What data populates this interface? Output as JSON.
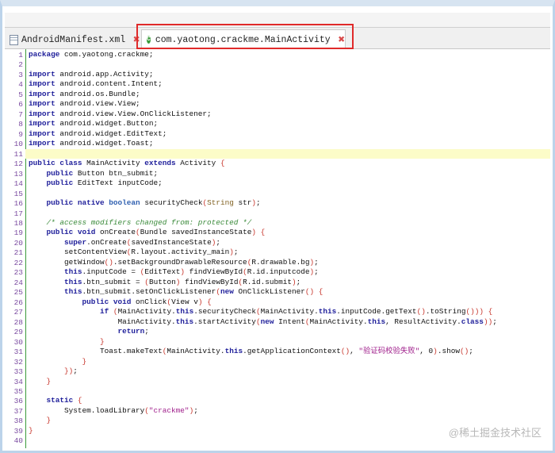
{
  "tabs": [
    {
      "label": "AndroidManifest.xml",
      "icon": "xml-file-icon",
      "active": false
    },
    {
      "label": "com.yaotong.crackme.MainActivity",
      "icon": "class-icon",
      "active": true
    }
  ],
  "current_line": 11,
  "watermark": "@稀土掘金技术社区",
  "code": [
    [
      [
        "k",
        "package"
      ],
      [
        "n",
        " com.yaotong.crackme;"
      ]
    ],
    [],
    [
      [
        "k",
        "import"
      ],
      [
        "n",
        " android.app.Activity;"
      ]
    ],
    [
      [
        "k",
        "import"
      ],
      [
        "n",
        " android.content.Intent;"
      ]
    ],
    [
      [
        "k",
        "import"
      ],
      [
        "n",
        " android.os.Bundle;"
      ]
    ],
    [
      [
        "k",
        "import"
      ],
      [
        "n",
        " android.view.View;"
      ]
    ],
    [
      [
        "k",
        "import"
      ],
      [
        "n",
        " android.view.View.OnClickListener;"
      ]
    ],
    [
      [
        "k",
        "import"
      ],
      [
        "n",
        " android.widget.Button;"
      ]
    ],
    [
      [
        "k",
        "import"
      ],
      [
        "n",
        " android.widget.EditText;"
      ]
    ],
    [
      [
        "k",
        "import"
      ],
      [
        "n",
        " android.widget.Toast;"
      ]
    ],
    [],
    [
      [
        "k",
        "public class"
      ],
      [
        "n",
        " MainActivity "
      ],
      [
        "k",
        "extends"
      ],
      [
        "n",
        " Activity "
      ],
      [
        "p",
        "{"
      ]
    ],
    [
      [
        "n",
        "    "
      ],
      [
        "k",
        "public"
      ],
      [
        "n",
        " Button btn_submit;"
      ]
    ],
    [
      [
        "n",
        "    "
      ],
      [
        "k",
        "public"
      ],
      [
        "n",
        " EditText inputCode;"
      ]
    ],
    [],
    [
      [
        "n",
        "    "
      ],
      [
        "k",
        "public native"
      ],
      [
        "n",
        " "
      ],
      [
        "t",
        "boolean"
      ],
      [
        "n",
        " securityCheck"
      ],
      [
        "p",
        "("
      ],
      [
        "ty",
        "String"
      ],
      [
        "n",
        " str"
      ],
      [
        "p",
        ")"
      ],
      [
        "n",
        ";"
      ]
    ],
    [],
    [
      [
        "n",
        "    "
      ],
      [
        "c",
        "/* access modifiers changed from: protected */"
      ]
    ],
    [
      [
        "n",
        "    "
      ],
      [
        "k",
        "public void"
      ],
      [
        "n",
        " onCreate"
      ],
      [
        "p",
        "("
      ],
      [
        "n",
        "Bundle savedInstanceState"
      ],
      [
        "p",
        ")"
      ],
      [
        "n",
        " "
      ],
      [
        "p",
        "{"
      ]
    ],
    [
      [
        "n",
        "        "
      ],
      [
        "k",
        "super"
      ],
      [
        "n",
        ".onCreate"
      ],
      [
        "p",
        "("
      ],
      [
        "n",
        "savedInstanceState"
      ],
      [
        "p",
        ")"
      ],
      [
        "n",
        ";"
      ]
    ],
    [
      [
        "n",
        "        setContentView"
      ],
      [
        "p",
        "("
      ],
      [
        "n",
        "R.layout.activity_main"
      ],
      [
        "p",
        ")"
      ],
      [
        "n",
        ";"
      ]
    ],
    [
      [
        "n",
        "        getWindow"
      ],
      [
        "p",
        "()"
      ],
      [
        "n",
        ".setBackgroundDrawableResource"
      ],
      [
        "p",
        "("
      ],
      [
        "n",
        "R.drawable.bg"
      ],
      [
        "p",
        ")"
      ],
      [
        "n",
        ";"
      ]
    ],
    [
      [
        "n",
        "        "
      ],
      [
        "k",
        "this"
      ],
      [
        "n",
        ".inputCode = "
      ],
      [
        "p",
        "("
      ],
      [
        "n",
        "EditText"
      ],
      [
        "p",
        ")"
      ],
      [
        "n",
        " findViewById"
      ],
      [
        "p",
        "("
      ],
      [
        "n",
        "R.id.inputcode"
      ],
      [
        "p",
        ")"
      ],
      [
        "n",
        ";"
      ]
    ],
    [
      [
        "n",
        "        "
      ],
      [
        "k",
        "this"
      ],
      [
        "n",
        ".btn_submit = "
      ],
      [
        "p",
        "("
      ],
      [
        "n",
        "Button"
      ],
      [
        "p",
        ")"
      ],
      [
        "n",
        " findViewById"
      ],
      [
        "p",
        "("
      ],
      [
        "n",
        "R.id.submit"
      ],
      [
        "p",
        ")"
      ],
      [
        "n",
        ";"
      ]
    ],
    [
      [
        "n",
        "        "
      ],
      [
        "k",
        "this"
      ],
      [
        "n",
        ".btn_submit.setOnClickListener"
      ],
      [
        "p",
        "("
      ],
      [
        "k",
        "new"
      ],
      [
        "n",
        " OnClickListener"
      ],
      [
        "p",
        "()"
      ],
      [
        "n",
        " "
      ],
      [
        "p",
        "{"
      ]
    ],
    [
      [
        "n",
        "            "
      ],
      [
        "k",
        "public void"
      ],
      [
        "n",
        " onClick"
      ],
      [
        "p",
        "("
      ],
      [
        "n",
        "View v"
      ],
      [
        "p",
        ")"
      ],
      [
        "n",
        " "
      ],
      [
        "p",
        "{"
      ]
    ],
    [
      [
        "n",
        "                "
      ],
      [
        "k",
        "if"
      ],
      [
        "n",
        " "
      ],
      [
        "p",
        "("
      ],
      [
        "n",
        "MainActivity."
      ],
      [
        "k",
        "this"
      ],
      [
        "n",
        ".securityCheck"
      ],
      [
        "p",
        "("
      ],
      [
        "n",
        "MainActivity."
      ],
      [
        "k",
        "this"
      ],
      [
        "n",
        ".inputCode.getText"
      ],
      [
        "p",
        "()"
      ],
      [
        "n",
        ".toString"
      ],
      [
        "p",
        "()))"
      ],
      [
        "n",
        " "
      ],
      [
        "p",
        "{"
      ]
    ],
    [
      [
        "n",
        "                    MainActivity."
      ],
      [
        "k",
        "this"
      ],
      [
        "n",
        ".startActivity"
      ],
      [
        "p",
        "("
      ],
      [
        "k",
        "new"
      ],
      [
        "n",
        " Intent"
      ],
      [
        "p",
        "("
      ],
      [
        "n",
        "MainActivity."
      ],
      [
        "k",
        "this"
      ],
      [
        "n",
        ", ResultActivity."
      ],
      [
        "k",
        "class"
      ],
      [
        "p",
        "))"
      ],
      [
        "n",
        ";"
      ]
    ],
    [
      [
        "n",
        "                    "
      ],
      [
        "k",
        "return"
      ],
      [
        "n",
        ";"
      ]
    ],
    [
      [
        "n",
        "                "
      ],
      [
        "p",
        "}"
      ]
    ],
    [
      [
        "n",
        "                Toast.makeText"
      ],
      [
        "p",
        "("
      ],
      [
        "n",
        "MainActivity."
      ],
      [
        "k",
        "this"
      ],
      [
        "n",
        ".getApplicationContext"
      ],
      [
        "p",
        "()"
      ],
      [
        "n",
        ", "
      ],
      [
        "s",
        "\"验证码校验失败\""
      ],
      [
        "n",
        ", 0"
      ],
      [
        "p",
        ")"
      ],
      [
        "n",
        ".show"
      ],
      [
        "p",
        "()"
      ],
      [
        "n",
        ";"
      ]
    ],
    [
      [
        "n",
        "            "
      ],
      [
        "p",
        "}"
      ]
    ],
    [
      [
        "n",
        "        "
      ],
      [
        "p",
        "})"
      ],
      [
        "n",
        ";"
      ]
    ],
    [
      [
        "n",
        "    "
      ],
      [
        "p",
        "}"
      ]
    ],
    [],
    [
      [
        "n",
        "    "
      ],
      [
        "k",
        "static"
      ],
      [
        "n",
        " "
      ],
      [
        "p",
        "{"
      ]
    ],
    [
      [
        "n",
        "        System.loadLibrary"
      ],
      [
        "p",
        "("
      ],
      [
        "s",
        "\"crackme\""
      ],
      [
        "p",
        ")"
      ],
      [
        "n",
        ";"
      ]
    ],
    [
      [
        "n",
        "    "
      ],
      [
        "p",
        "}"
      ]
    ],
    [
      [
        "p",
        "}"
      ]
    ],
    []
  ]
}
